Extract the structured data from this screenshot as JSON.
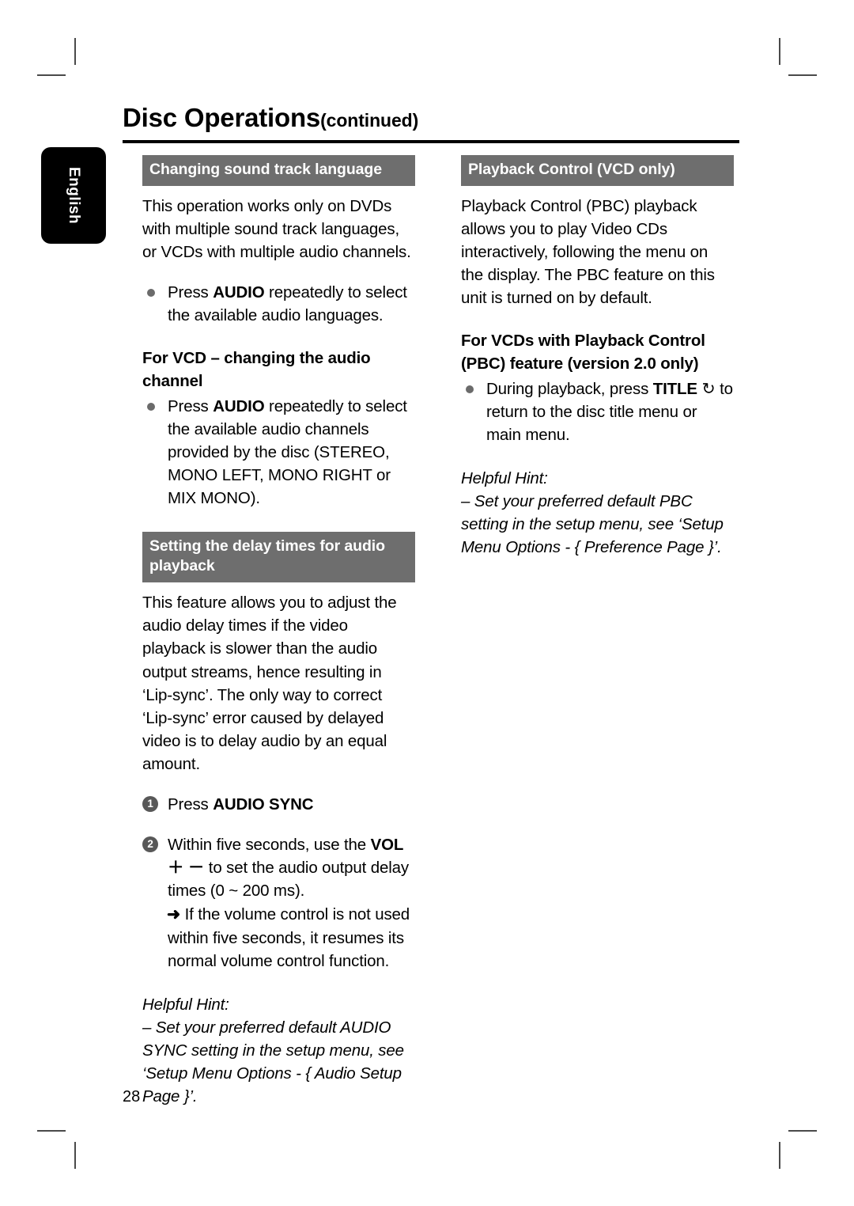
{
  "page": {
    "number": "28",
    "language_tab": "English"
  },
  "header": {
    "title_main": "Disc Operations",
    "title_suffix": "(continued)"
  },
  "left_column": {
    "section1": {
      "bar_title": "Changing sound track language",
      "intro": "This operation works only on DVDs with multiple sound track languages, or VCDs with multiple audio channels.",
      "bullet1_pre": "Press ",
      "bullet1_kw": "AUDIO",
      "bullet1_post": " repeatedly to select the available audio languages.",
      "subhead": "For VCD – changing the audio channel",
      "bullet2_pre": "Press ",
      "bullet2_kw": "AUDIO",
      "bullet2_post": " repeatedly to select the available audio channels provided by the disc (STEREO, MONO LEFT, MONO RIGHT or MIX MONO)."
    },
    "section2": {
      "bar_title": "Setting the delay times for audio playback",
      "intro": "This feature allows you to adjust the audio delay times if the video playback is slower than the audio output streams, hence resulting in ‘Lip-sync’. The only way to correct ‘Lip-sync’ error caused by delayed video is to delay audio by an equal amount.",
      "step1_num": "1",
      "step1_pre": "Press ",
      "step1_kw": "AUDIO SYNC",
      "step2_num": "2",
      "step2_pre": "Within five seconds, use the ",
      "step2_kw": "VOL",
      "step2_symbols": " ＋ －",
      "step2_post": " to set the audio output delay times (0 ~ 200 ms).",
      "step2_sub_arrow": "➜",
      "step2_sub": " If the volume control is not used within five seconds, it resumes its normal volume control function.",
      "hint_title": "Helpful Hint:",
      "hint_body": "– Set your preferred default AUDIO SYNC setting in the setup menu, see ‘Setup Menu Options - { Audio Setup Page }’."
    }
  },
  "right_column": {
    "section1": {
      "bar_title": "Playback Control (VCD only)",
      "intro": "Playback Control (PBC) playback allows you to play Video CDs interactively, following the menu on the display. The PBC feature on this unit is turned on by default.",
      "subhead": "For VCDs with Playback Control (PBC) feature (version 2.0 only)",
      "bullet1_pre": "During playback, press ",
      "bullet1_kw": "TITLE",
      "bullet1_symbol": " ↻",
      "bullet1_post": " to return to the disc title menu or main menu.",
      "hint_title": "Helpful Hint:",
      "hint_body": "– Set your preferred default PBC setting in the setup menu, see ‘Setup Menu Options - { Preference Page }’."
    }
  },
  "colors": {
    "bar_gray": "#6e6e6e",
    "bullet_gray": "#6b6b6b",
    "step_circle_gray": "#585858",
    "tab_black": "#000000"
  }
}
